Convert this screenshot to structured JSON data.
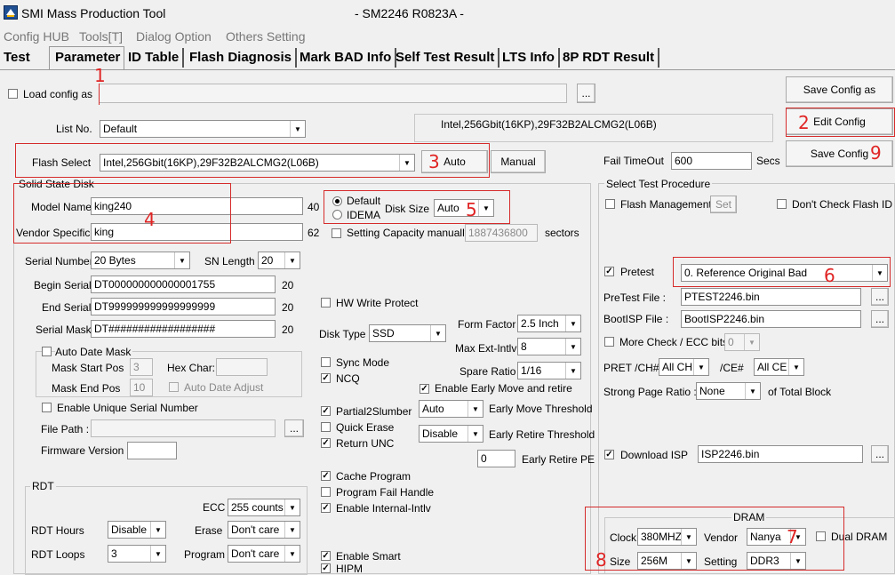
{
  "window": {
    "title": "SMI Mass Production Tool",
    "subtitle": "- SM2246 R0823A -"
  },
  "menu": [
    "Config HUB",
    "Tools[T]",
    "Dialog Option",
    "Others Setting"
  ],
  "tabs": [
    "Test",
    "Parameter",
    "ID Table",
    "Flash Diagnosis",
    "Mark BAD Info",
    "Self Test Result",
    "LTS Info",
    "8P RDT Result"
  ],
  "config": {
    "load_config_label": "Load config as",
    "load_config_path": "",
    "browse": "...",
    "list_no_label": "List No.",
    "list_no_value": "Default",
    "flash_info": "Intel,256Gbit(16KP),29F32B2ALCMG2(L06B)",
    "save_config_as": "Save Config as",
    "edit_config": "Edit Config",
    "save_config": "Save Config",
    "flash_select_label": "Flash Select",
    "flash_select_value": "Intel,256Gbit(16KP),29F32B2ALCMG2(L06B)",
    "auto_button": "Auto",
    "manual_button": "Manual",
    "fail_timeout_label": "Fail TimeOut",
    "fail_timeout_value": "600",
    "secs": "Secs"
  },
  "ssd": {
    "group_label": "Solid State Disk",
    "model_name_label": "Model Name",
    "model_name_value": "king240",
    "model_name_len": "40",
    "vendor_label": "Vendor Specific",
    "vendor_value": "king",
    "vendor_len": "62",
    "default_label": "Default",
    "idema_label": "IDEMA",
    "disk_size_label": "Disk Size",
    "disk_size_value": "Auto",
    "capacity_label": "Setting Capacity manually",
    "capacity_value": "1887436800",
    "sectors": "sectors",
    "serial_number_label": "Serial Number",
    "serial_number_value": "20 Bytes",
    "sn_length_label": "SN Length",
    "sn_length_value": "20",
    "begin_serial_label": "Begin Serial",
    "begin_serial_value": "DT000000000000001755",
    "begin_serial_len": "20",
    "end_serial_label": "End Serial",
    "end_serial_value": "DT999999999999999999",
    "end_serial_len": "20",
    "serial_mask_label": "Serial Mask",
    "serial_mask_value": "DT##################",
    "serial_mask_len": "20",
    "auto_date_mask_label": "Auto Date Mask",
    "mask_start_label": "Mask Start Pos",
    "mask_start_value": "3",
    "hex_char_label": "Hex Char:",
    "mask_end_label": "Mask End Pos",
    "mask_end_value": "10",
    "auto_date_adjust_label": "Auto Date Adjust",
    "unique_serial_label": "Enable Unique Serial Number",
    "file_path_label": "File Path :",
    "firmware_version_label": "Firmware Version",
    "hw_write_protect": "HW Write Protect",
    "disk_type_label": "Disk Type",
    "disk_type_value": "SSD",
    "form_factor_label": "Form Factor",
    "form_factor_value": "2.5 Inch",
    "max_ext_label": "Max Ext-Intlv",
    "max_ext_value": "8",
    "spare_ratio_label": "Spare Ratio",
    "spare_ratio_value": "1/16",
    "sync_mode": "Sync Mode",
    "ncq": "NCQ",
    "early_move_retire": "Enable Early Move and retire",
    "partial_slumber": "Partial2Slumber",
    "quick_erase": "Quick Erase",
    "return_unc": "Return UNC",
    "early_move_value": "Auto",
    "early_move_label": "Early Move Threshold",
    "early_retire_value": "Disable",
    "early_retire_label": "Early Retire Threshold",
    "early_retire_pe_value": "0",
    "early_retire_pe_label": "Early Retire PE",
    "cache_program": "Cache Program",
    "program_fail": "Program Fail Handle",
    "internal_intlv": "Enable Internal-Intlv",
    "enable_smart": "Enable Smart",
    "hipm": "HIPM"
  },
  "rdt": {
    "group_label": "RDT",
    "ecc_label": "ECC",
    "ecc_value": "255 counts",
    "hours_label": "RDT Hours",
    "hours_value": "Disable",
    "erase_label": "Erase",
    "erase_value": "Don't care",
    "loops_label": "RDT Loops",
    "loops_value": "3",
    "program_label": "Program",
    "program_value": "Don't care"
  },
  "procedure": {
    "group_label": "Select Test Procedure",
    "flash_management": "Flash Management",
    "set_button": "Set",
    "dont_check_id": "Don't Check Flash ID",
    "pretest_label": "Pretest",
    "pretest_value": "0. Reference Original Bad",
    "pretest_file_label": "PreTest File :",
    "pretest_file_value": "PTEST2246.bin",
    "bootisp_label": "BootISP File :",
    "bootisp_value": "BootISP2246.bin",
    "more_check_label": "More Check / ECC bits",
    "more_check_value": "0",
    "pret_ch_label": "PRET /CH#",
    "pret_ch_value": "All CH",
    "ce_label": "/CE#",
    "ce_value": "All CE",
    "strong_page_label": "Strong Page Ratio :",
    "strong_page_value": "None",
    "of_total_block": "of Total Block",
    "download_isp_label": "Download ISP",
    "download_isp_value": "ISP2246.bin"
  },
  "dram": {
    "group_label": "DRAM",
    "clock_label": "Clock",
    "clock_value": "380MHZ",
    "vendor_label": "Vendor",
    "vendor_value": "Nanya",
    "dual_dram": "Dual DRAM",
    "size_label": "Size",
    "size_value": "256M",
    "setting_label": "Setting",
    "setting_value": "DDR3"
  },
  "annotations": [
    "1",
    "2",
    "3",
    "4",
    "5",
    "6",
    "7",
    "8",
    "9"
  ],
  "colors": {
    "annotation_red": "#d62b2b",
    "background": "#f0f0f0"
  }
}
